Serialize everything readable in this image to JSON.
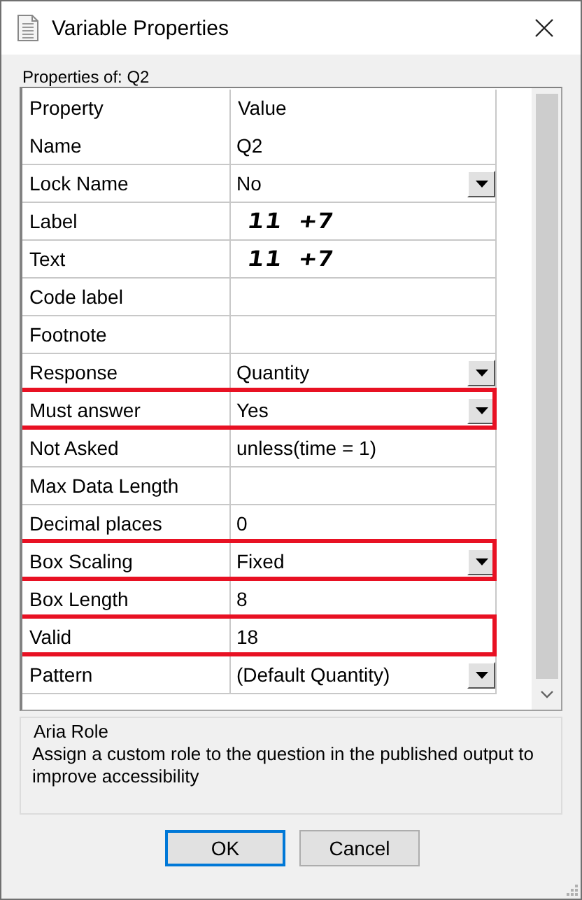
{
  "window": {
    "title": "Variable Properties"
  },
  "subtitle": "Properties of: Q2",
  "table": {
    "columns": [
      "Property",
      "Value"
    ],
    "rows": [
      {
        "name": "Name",
        "kind": "text",
        "value": "Q2",
        "highlighted": false
      },
      {
        "name": "Lock Name",
        "kind": "dropdown",
        "value": "No",
        "highlighted": false
      },
      {
        "name": "Label",
        "kind": "handwriting",
        "value": "11 +7",
        "highlighted": false
      },
      {
        "name": "Text",
        "kind": "handwriting",
        "value": "11 +7",
        "highlighted": false
      },
      {
        "name": "Code label",
        "kind": "text",
        "highlighted": false
      },
      {
        "name": "Footnote",
        "kind": "text",
        "highlighted": false
      },
      {
        "name": "Response",
        "kind": "dropdown",
        "value": "Quantity",
        "highlighted": false
      },
      {
        "name": "Must answer",
        "kind": "dropdown",
        "value": "Yes",
        "highlighted": true
      },
      {
        "name": "Not Asked",
        "kind": "text",
        "value": "unless(time = 1)",
        "highlighted": false
      },
      {
        "name": "Max Data Length",
        "kind": "text",
        "highlighted": false
      },
      {
        "name": "Decimal places",
        "kind": "text",
        "value": "0",
        "highlighted": false
      },
      {
        "name": "Box Scaling",
        "kind": "dropdown",
        "value": "Fixed",
        "highlighted": true
      },
      {
        "name": "Box Length",
        "kind": "text",
        "value": "8",
        "highlighted": false
      },
      {
        "name": "Valid",
        "kind": "text",
        "value": "18",
        "highlighted": true
      },
      {
        "name": "Pattern",
        "kind": "dropdown",
        "value": "(Default Quantity)",
        "highlighted": false
      }
    ]
  },
  "description": {
    "title": "Aria Role",
    "text": "Assign a custom role to the question in the published output to improve accessibility"
  },
  "buttons": [
    {
      "label": "OK",
      "default": true
    },
    {
      "label": "Cancel",
      "default": false
    }
  ]
}
